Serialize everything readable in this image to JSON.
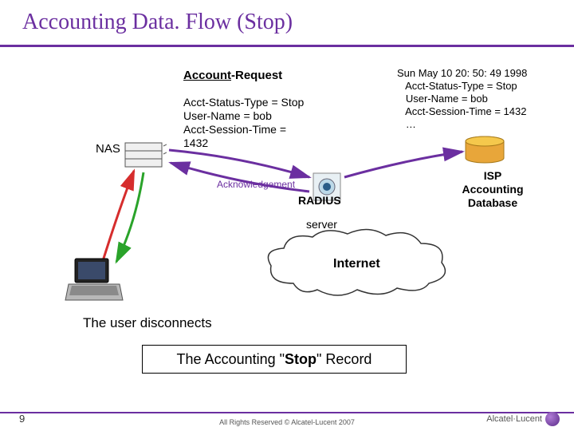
{
  "title": "Accounting Data. Flow (Stop)",
  "account_request": {
    "heading_prefix": "Account",
    "heading_suffix": "-Request",
    "body": "Acct-Status-Type = Stop\nUser-Name = bob\nAcct-Session-Time =\n1432"
  },
  "acknowledgement_label": "Acknowledgement",
  "nas_label": "NAS",
  "radius_label": "RADIUS",
  "server_label": "server",
  "db": {
    "log": "Sun May 10 20: 50: 49 1998\n   Acct-Status-Type = Stop\n   User-Name = bob\n   Acct-Session-Time = 1432\n   …",
    "title": "ISP\nAccounting\nDatabase"
  },
  "internet_label": "Internet",
  "user_disconnect": "The user disconnects",
  "stop_record_prefix": "The Accounting \"",
  "stop_record_word": "Stop",
  "stop_record_suffix": "\" Record",
  "page_number": "9",
  "copyright": "All Rights Reserved © Alcatel-Lucent 2007",
  "logo_text": "Alcatel·Lucent"
}
